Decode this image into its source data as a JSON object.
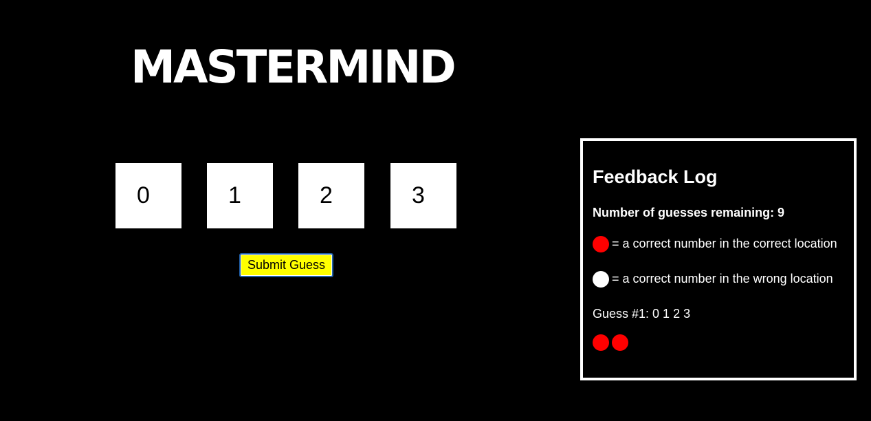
{
  "game": {
    "title": "MASTERMIND",
    "digits": [
      "0",
      "1",
      "2",
      "3"
    ],
    "submit_label": "Submit Guess"
  },
  "feedback_log": {
    "title": "Feedback Log",
    "remaining_text": "Number of guesses remaining: 9",
    "legend": {
      "red_text": "= a correct number in the correct location",
      "white_text": "= a correct number in the wrong location"
    },
    "guesses": [
      {
        "text": "Guess #1: 0 1 2 3",
        "red_pegs": 2,
        "white_pegs": 0
      }
    ]
  },
  "colors": {
    "background": "#000000",
    "red_peg": "#ff0000",
    "white_peg": "#ffffff",
    "submit_button": "#ffff00"
  },
  "icons": {
    "red_peg": "red-circle-icon",
    "white_peg": "white-circle-icon"
  }
}
